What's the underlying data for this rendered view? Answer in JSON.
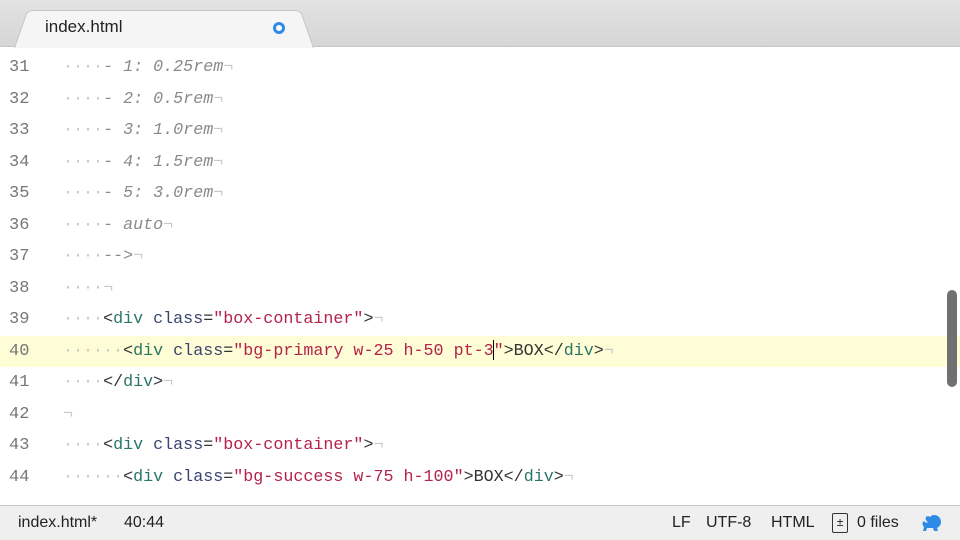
{
  "tab": {
    "title": "index.html",
    "modified_indicator": true
  },
  "editor": {
    "current_line": "40",
    "lines": [
      {
        "num": "31",
        "ws": "····",
        "tokens": [
          {
            "t": "- 1: 0.25rem",
            "c": "comment"
          }
        ]
      },
      {
        "num": "32",
        "ws": "····",
        "tokens": [
          {
            "t": "- 2: 0.5rem",
            "c": "comment"
          }
        ]
      },
      {
        "num": "33",
        "ws": "····",
        "tokens": [
          {
            "t": "- 3: 1.0rem",
            "c": "comment"
          }
        ]
      },
      {
        "num": "34",
        "ws": "····",
        "tokens": [
          {
            "t": "- 4: 1.5rem",
            "c": "comment"
          }
        ]
      },
      {
        "num": "35",
        "ws": "····",
        "tokens": [
          {
            "t": "- 5: 3.0rem",
            "c": "comment"
          }
        ]
      },
      {
        "num": "36",
        "ws": "····",
        "tokens": [
          {
            "t": "- auto",
            "c": "comment"
          }
        ]
      },
      {
        "num": "37",
        "ws": "····",
        "tokens": [
          {
            "t": "-->",
            "c": "comment"
          }
        ]
      },
      {
        "num": "38",
        "ws": "····",
        "tokens": []
      },
      {
        "num": "39",
        "ws": "····",
        "tokens": [
          {
            "t": "<",
            "c": "text"
          },
          {
            "t": "div",
            "c": "tag"
          },
          {
            "t": " class",
            "c": "attr"
          },
          {
            "t": "=",
            "c": "text"
          },
          {
            "t": "\"box-container\"",
            "c": "str"
          },
          {
            "t": ">",
            "c": "text"
          }
        ]
      },
      {
        "num": "40",
        "ws": "······",
        "tokens": [
          {
            "t": "<",
            "c": "text"
          },
          {
            "t": "div",
            "c": "tag"
          },
          {
            "t": " class",
            "c": "attr"
          },
          {
            "t": "=",
            "c": "text"
          },
          {
            "t": "\"bg-primary w-25 h-50 pt-3",
            "c": "str"
          },
          {
            "t": "|",
            "c": "caret"
          },
          {
            "t": "\"",
            "c": "str"
          },
          {
            "t": ">BOX</",
            "c": "text"
          },
          {
            "t": "div",
            "c": "tag"
          },
          {
            "t": ">",
            "c": "text"
          }
        ]
      },
      {
        "num": "41",
        "ws": "····",
        "tokens": [
          {
            "t": "</",
            "c": "text"
          },
          {
            "t": "div",
            "c": "tag"
          },
          {
            "t": ">",
            "c": "text"
          }
        ]
      },
      {
        "num": "42",
        "ws": "",
        "tokens": []
      },
      {
        "num": "43",
        "ws": "····",
        "tokens": [
          {
            "t": "<",
            "c": "text"
          },
          {
            "t": "div",
            "c": "tag"
          },
          {
            "t": " class",
            "c": "attr"
          },
          {
            "t": "=",
            "c": "text"
          },
          {
            "t": "\"box-container\"",
            "c": "str"
          },
          {
            "t": ">",
            "c": "text"
          }
        ]
      },
      {
        "num": "44",
        "ws": "······",
        "tokens": [
          {
            "t": "<",
            "c": "text"
          },
          {
            "t": "div",
            "c": "tag"
          },
          {
            "t": " class",
            "c": "attr"
          },
          {
            "t": "=",
            "c": "text"
          },
          {
            "t": "\"bg-success w-75 h-100\"",
            "c": "str"
          },
          {
            "t": ">BOX</",
            "c": "text"
          },
          {
            "t": "div",
            "c": "tag"
          },
          {
            "t": ">",
            "c": "text"
          }
        ]
      }
    ],
    "eol_marker": "¬"
  },
  "status": {
    "filename": "index.html*",
    "cursor": "40:44",
    "line_ending": "LF",
    "encoding": "UTF-8",
    "grammar": "HTML",
    "git_files": "0 files"
  },
  "colors": {
    "accent": "#2e8ae6",
    "current_line": "#fefdd6",
    "string": "#b3234a",
    "tag": "#2b7567",
    "attr": "#3a4470"
  }
}
